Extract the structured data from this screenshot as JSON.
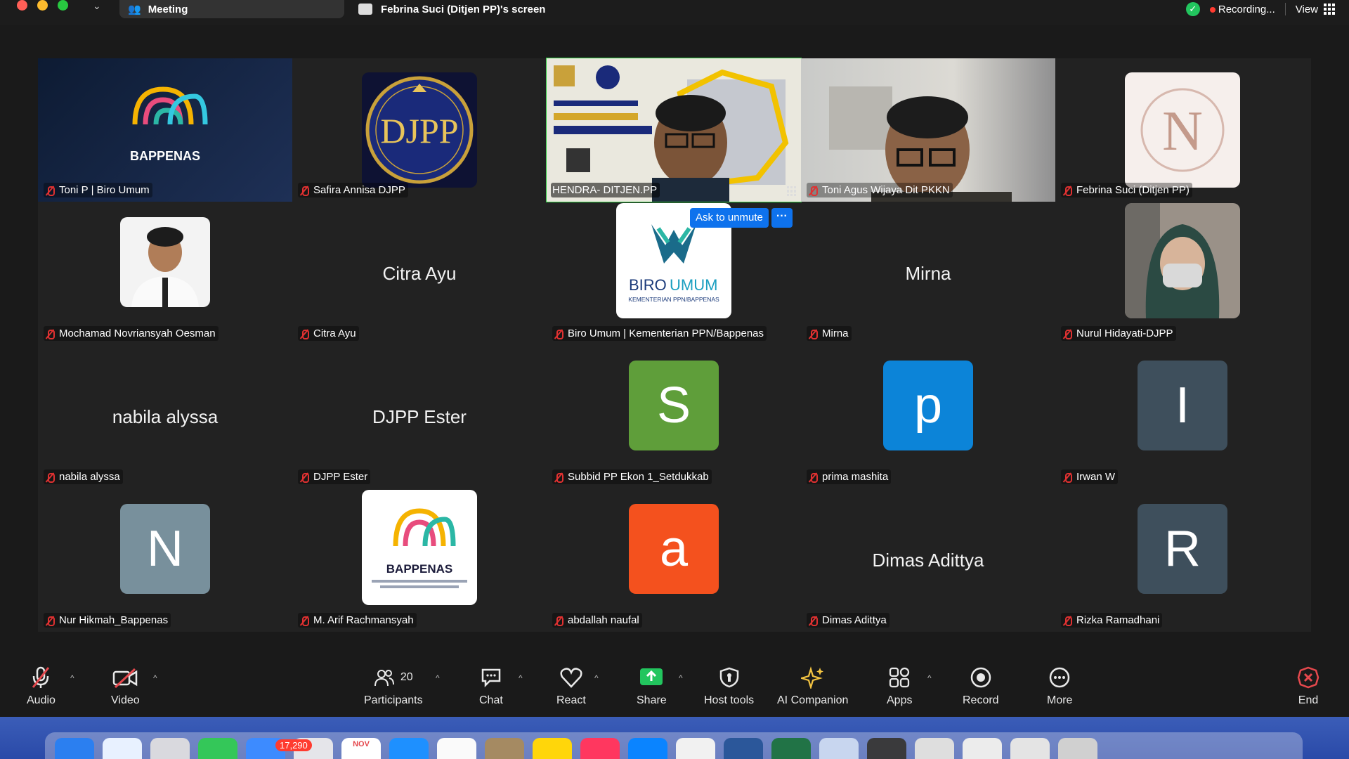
{
  "topbar": {
    "meeting_label": "Meeting",
    "share_label": "Febrina Suci (Ditjen PP)'s screen",
    "recording_label": "Recording...",
    "view_label": "View"
  },
  "ask_unmute": {
    "label": "Ask to unmute",
    "more": "···"
  },
  "tiles": [
    {
      "name": "Toni P | Biro Umum",
      "kind": "logo",
      "logo_text": "BAPPENAS"
    },
    {
      "name": "Safira Annisa DJPP",
      "kind": "logo",
      "logo_text": "DJPP"
    },
    {
      "name": "HENDRA- DITJEN.PP",
      "kind": "video"
    },
    {
      "name": "Toni Agus Wijaya Dit PKKN",
      "kind": "video"
    },
    {
      "name": "Febrina Suci (Ditjen PP)",
      "kind": "logo",
      "logo_text": "N"
    },
    {
      "name": "Mochamad Novriansyah Oesman",
      "kind": "photo"
    },
    {
      "name": "Citra Ayu",
      "kind": "text",
      "display": "Citra Ayu"
    },
    {
      "name": "Biro Umum | Kementerian PPN/Bappenas",
      "kind": "logo",
      "logo_text": "BIROUMUM"
    },
    {
      "name": "Mirna",
      "kind": "text",
      "display": "Mirna"
    },
    {
      "name": "Nurul Hidayati-DJPP",
      "kind": "photo"
    },
    {
      "name": "nabila alyssa",
      "kind": "text",
      "display": "nabila alyssa"
    },
    {
      "name": "DJPP Ester",
      "kind": "text",
      "display": "DJPP Ester"
    },
    {
      "name": "Subbid PP Ekon 1_Setdukkab",
      "kind": "avatar",
      "letter": "S",
      "color": "#5f9e3a"
    },
    {
      "name": "prima mashita",
      "kind": "avatar",
      "letter": "p",
      "color": "#0c84d8"
    },
    {
      "name": "Irwan W",
      "kind": "avatar",
      "letter": "I",
      "color": "#3e4f5c"
    },
    {
      "name": "Nur Hikmah_Bappenas",
      "kind": "avatar",
      "letter": "N",
      "color": "#78909c"
    },
    {
      "name": "M. Arif Rachmansyah",
      "kind": "logo",
      "logo_text": "BAPPENAS"
    },
    {
      "name": "abdallah naufal",
      "kind": "avatar",
      "letter": "a",
      "color": "#f4511e"
    },
    {
      "name": "Dimas Adittya",
      "kind": "text",
      "display": "Dimas Adittya"
    },
    {
      "name": "Rizka Ramadhani",
      "kind": "avatar",
      "letter": "R",
      "color": "#3e4f5c"
    }
  ],
  "logos": {
    "bappenas": "BAPPENAS",
    "djpp": "DJPP",
    "febrina": "N",
    "biro_a": "BIRO",
    "biro_b": "UMUM",
    "biro_sub": "KEMENTERIAN PPN/BAPPENAS"
  },
  "toolbar": {
    "audio": "Audio",
    "video": "Video",
    "participants": "Participants",
    "participants_count": "20",
    "chat": "Chat",
    "react": "React",
    "share": "Share",
    "host_tools": "Host tools",
    "ai_companion": "AI Companion",
    "apps": "Apps",
    "record": "Record",
    "more": "More",
    "end": "End"
  },
  "dock": {
    "mail_badge": "17,290",
    "calendar_month": "NOV"
  },
  "colors": {
    "active_speaker": "#2ecc40",
    "accent": "#0e72ed",
    "muted": "#e03131",
    "end": "#e5484d",
    "share": "#22c55e"
  }
}
